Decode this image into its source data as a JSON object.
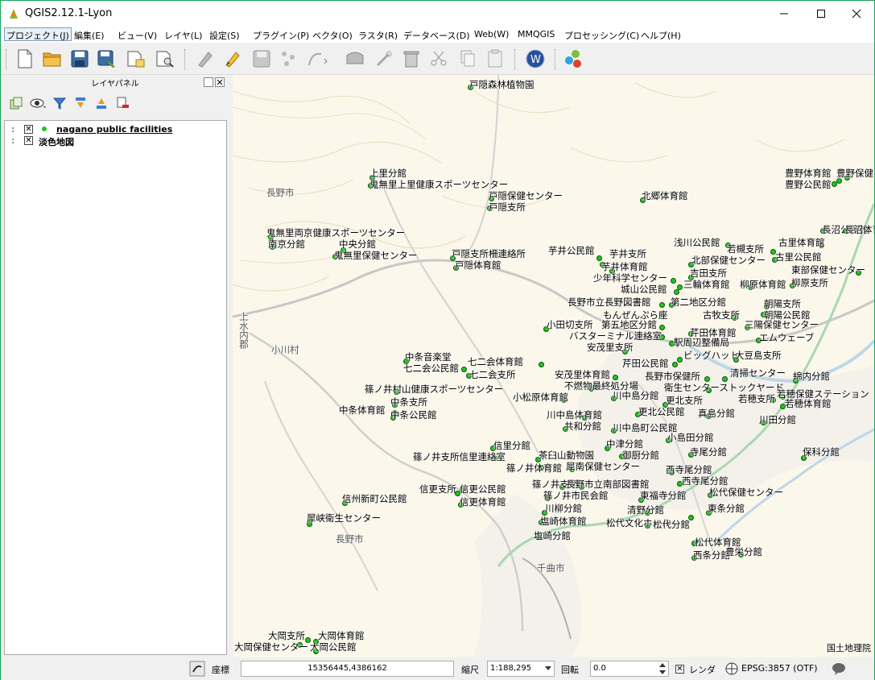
{
  "window": {
    "title": "QGIS2.12.1-Lyon"
  },
  "menu": [
    "プロジェクト(J)",
    "編集(E)",
    "ビュー(V)",
    "レイヤ(L)",
    "設定(S)",
    "プラグイン(P)",
    "ベクタ(O)",
    "ラスタ(R)",
    "データベース(D)",
    "Web(W)",
    "MMQGIS",
    "プロセッシング(C)",
    "ヘルプ(H)"
  ],
  "toolbar_icons": [
    "new-project-icon",
    "open-project-icon",
    "save-project-icon",
    "save-as-icon",
    "print-composer-icon",
    "composer-manager-icon",
    "digitize-icon",
    "edit-pencil-icon",
    "save-edits-icon",
    "add-feature-icon",
    "move-feature-icon",
    "node-tool-icon",
    "delete-selected-icon",
    "cut-icon",
    "copy-icon",
    "paste-icon",
    "web-plugin-icon",
    "openlayers-plugin-icon"
  ],
  "layer_panel": {
    "title": "レイヤパネル",
    "layers": [
      {
        "name": "nagano public facilities",
        "checked": true
      },
      {
        "name": "淡色地図",
        "checked": true
      }
    ]
  },
  "map": {
    "attribution": "国土地理院",
    "accent_color": "#1ec81e",
    "base_labels": [
      "長野市",
      "小川村",
      "上水内郡",
      "長野市",
      "千曲市"
    ],
    "facilities": [
      "戸隠森林植物園",
      "上里分館",
      "鬼無里上里健康スポーツセンター",
      "戸隠保健センター",
      "戸隠支所",
      "北郷体育館",
      "豊野体育館",
      "豊野保健",
      "豊野公民館",
      "長沼公民館",
      "長沼体育館",
      "鬼無里両京健康スポーツセンター",
      "南京分館",
      "中央分館",
      "鬼無里保健センター",
      "戸隠支所柵連絡所",
      "戸隠体育館",
      "芋井公民館",
      "芋井支所",
      "芋井体育館",
      "浅川公民館",
      "若槻支所",
      "古里体育館",
      "北部保健センター",
      "古里公民館",
      "吉田支所",
      "東部保健センター",
      "少年科学センター",
      "三輪体育館",
      "柳原体育館",
      "柳原支所",
      "城山公民館",
      "長野市立長野図書館",
      "第二地区分館",
      "朝陽支所",
      "もんぜんぷら座",
      "古牧支所",
      "朝陽公民館",
      "小田切支所",
      "第五地区分館",
      "芹田体育館",
      "三陽保健センター",
      "バスターミナル連絡室",
      "エムウェーブ",
      "駅周辺整備局",
      "安茂里支所",
      "ビッグハット",
      "大豆島支所",
      "中条音楽堂",
      "七二会体育館",
      "七二会公民館",
      "七二会支所",
      "芹田公民館",
      "安茂里体育館",
      "長野市保健所",
      "清掃センター",
      "綿内分館",
      "不燃物最終処分場",
      "衛生センターストックヤード",
      "篠ノ井村山健康スポーツセンター",
      "小松原体育館",
      "川中島分館",
      "若穂支所",
      "若穂保健ステーション",
      "中条支所",
      "若穂体育館",
      "中条体育館",
      "中条公民館",
      "更北支所",
      "更北公民館",
      "真島分館",
      "川中島体育館",
      "川田分館",
      "共和分館",
      "川中島町公民館",
      "中津分館",
      "小島田分館",
      "信里分館",
      "御厨分館",
      "篠ノ井支所信里連絡室",
      "茶臼山動物園",
      "寺尾分館",
      "保科分館",
      "篠ノ井体育館",
      "犀南保健センター",
      "西寺尾分館",
      "西寺尾分館",
      "篠ノ井支所",
      "長野市立南部図書館",
      "信更支所",
      "信更公民館",
      "篠ノ井市民会館",
      "東福寺分館",
      "松代保健センター",
      "信州新町公民館",
      "信更体育館",
      "川柳分館",
      "清野分館",
      "東条分館",
      "犀峡衛生センター",
      "塩崎体育館",
      "松代文化ホール",
      "松代分館",
      "塩崎分館",
      "松代体育館",
      "西条分館",
      "豊栄分館",
      "大岡支所",
      "大岡体育館",
      "大岡保健センター",
      "大岡公民館"
    ]
  },
  "status": {
    "coord_label": "座標",
    "coord_value": "15356445,4386162",
    "scale_label": "縮尺",
    "scale_value": "1:188,295",
    "rotation_label": "回転",
    "rotation_value": "0.0",
    "render_label": "レンダ",
    "crs": "EPSG:3857 (OTF)"
  }
}
